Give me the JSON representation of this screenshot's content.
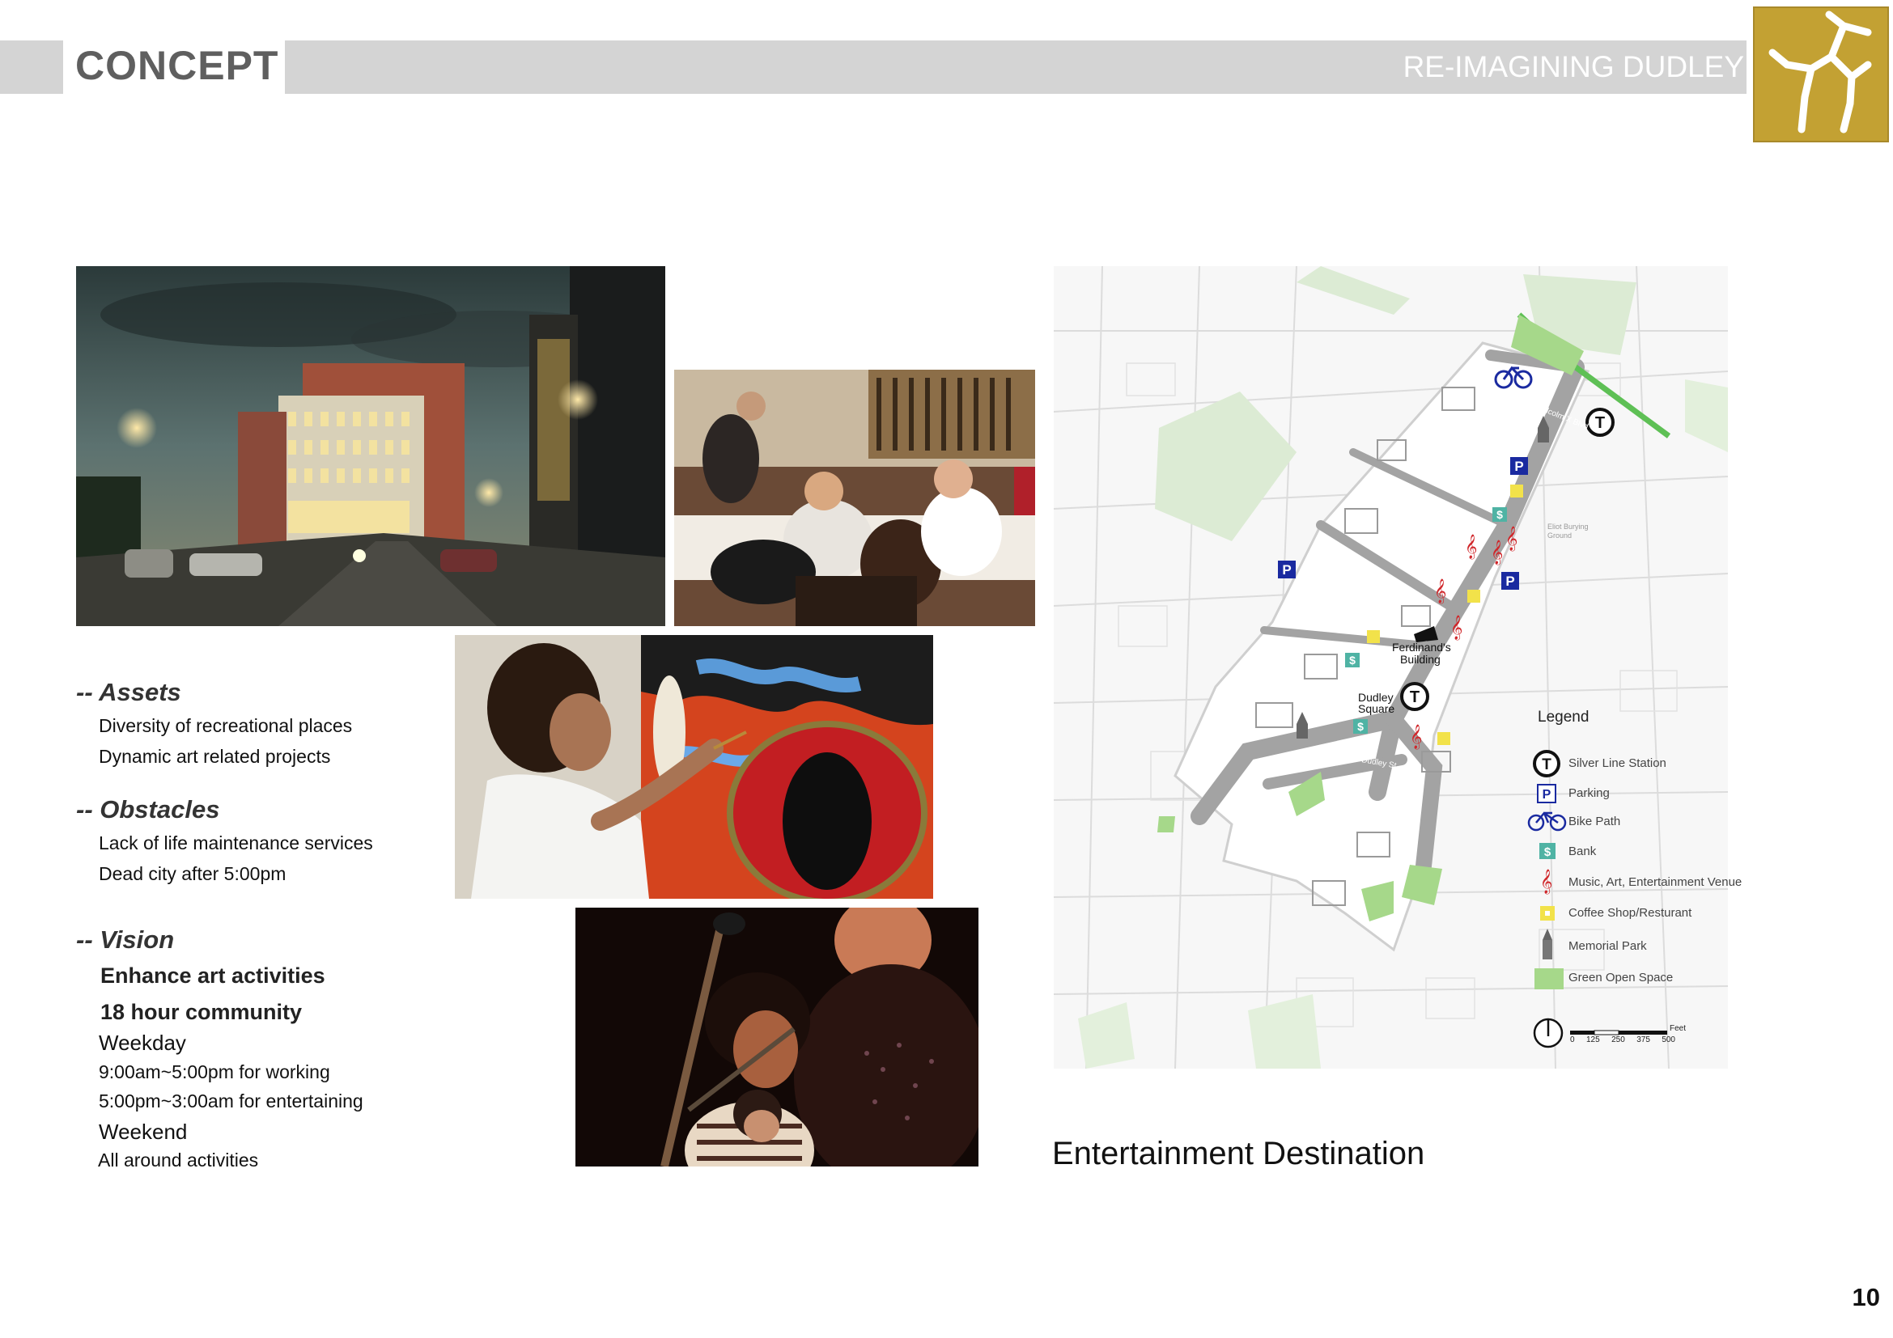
{
  "header": {
    "section": "CONCEPT",
    "project": "RE-IMAGINING DUDLEY"
  },
  "colors": {
    "accent_gold": "#c3a133",
    "header_gray": "#d4d4d4",
    "map_green": "#a6d88a",
    "parking_blue": "#1a2aa0",
    "bank_teal": "#4fb3a4",
    "music_red": "#d0262a",
    "coffee_yellow": "#f2e24a"
  },
  "photos": [
    {
      "name": "street-night-rendering"
    },
    {
      "name": "restaurant-dining"
    },
    {
      "name": "artist-painting-mural"
    },
    {
      "name": "singer-performance"
    }
  ],
  "assets": {
    "heading": "-- Assets",
    "items": [
      "Diversity of recreational places",
      "Dynamic art related projects"
    ]
  },
  "obstacles": {
    "heading": "-- Obstacles",
    "items": [
      "Lack of life maintenance services",
      "Dead city after 5:00pm"
    ]
  },
  "vision": {
    "heading": "-- Vision",
    "items": [
      "Enhance art activities",
      "18 hour community",
      "Weekday",
      "9:00am~5:00pm for working",
      "5:00pm~3:00am for entertaining",
      "Weekend",
      "All around activities"
    ]
  },
  "map": {
    "title": "Entertainment Destination",
    "labels": {
      "ferdinands": "Ferdinand's\nBuilding",
      "dudley_square": "Dudley\nSquare",
      "street_dudley": "Dudley St",
      "street_malcolm": "Malcolm X Blvd",
      "eliot": "Eliot Burying\nGround"
    },
    "legend_title": "Legend",
    "legend": [
      {
        "icon": "t-station-icon",
        "label": "Silver Line Station"
      },
      {
        "icon": "parking-icon",
        "label": "Parking"
      },
      {
        "icon": "bicycle-icon",
        "label": "Bike Path"
      },
      {
        "icon": "bank-icon",
        "label": "Bank"
      },
      {
        "icon": "music-note-icon",
        "label": "Music, Art, Entertainment Venue"
      },
      {
        "icon": "coffee-icon",
        "label": "Coffee Shop/Resturant"
      },
      {
        "icon": "memorial-icon",
        "label": "Memorial Park"
      },
      {
        "icon": "green-space-icon",
        "label": "Green Open Space"
      }
    ],
    "scale": {
      "unit": "Feet",
      "ticks": [
        "0",
        "125",
        "250",
        "375",
        "500"
      ]
    }
  },
  "page_number": "10"
}
